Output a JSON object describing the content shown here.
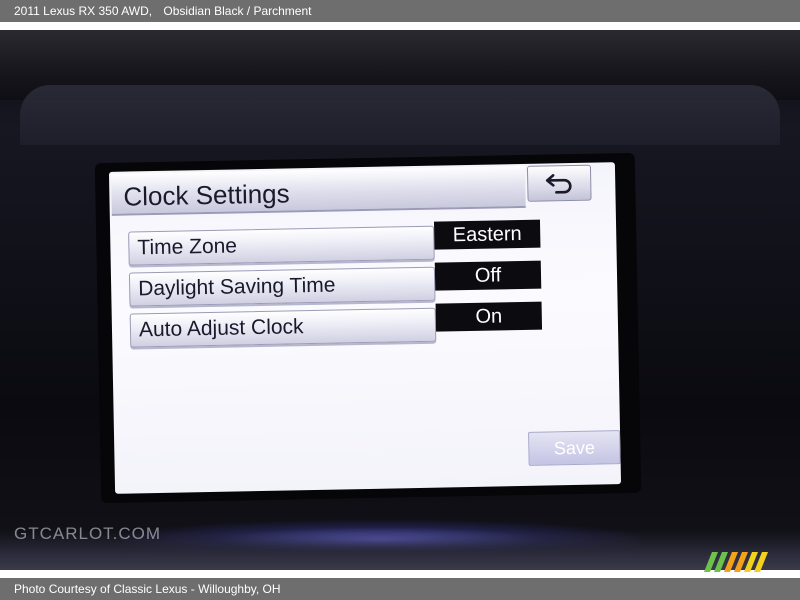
{
  "caption": {
    "title": "2011 Lexus RX 350 AWD,",
    "subtitle": "Obsidian Black / Parchment",
    "photo_credit": "Photo Courtesy of Classic Lexus - Willoughby, OH"
  },
  "watermark": {
    "text": "GTCARLOT.COM"
  },
  "screen": {
    "title": "Clock Settings",
    "back_icon": "return-arrow-icon",
    "settings": [
      {
        "label": "Time Zone",
        "value": "Eastern"
      },
      {
        "label": "Daylight Saving Time",
        "value": "Off"
      },
      {
        "label": "Auto Adjust Clock",
        "value": "On"
      }
    ],
    "save_label": "Save",
    "save_enabled": false
  },
  "colors": {
    "caption_bar": "#6e6e6e",
    "screen_background": "#f8f8fd",
    "value_box": "#0c0c10",
    "save_disabled": "#c4c4e4",
    "logo_green": "#6cc24a",
    "logo_orange": "#f3a21c"
  }
}
